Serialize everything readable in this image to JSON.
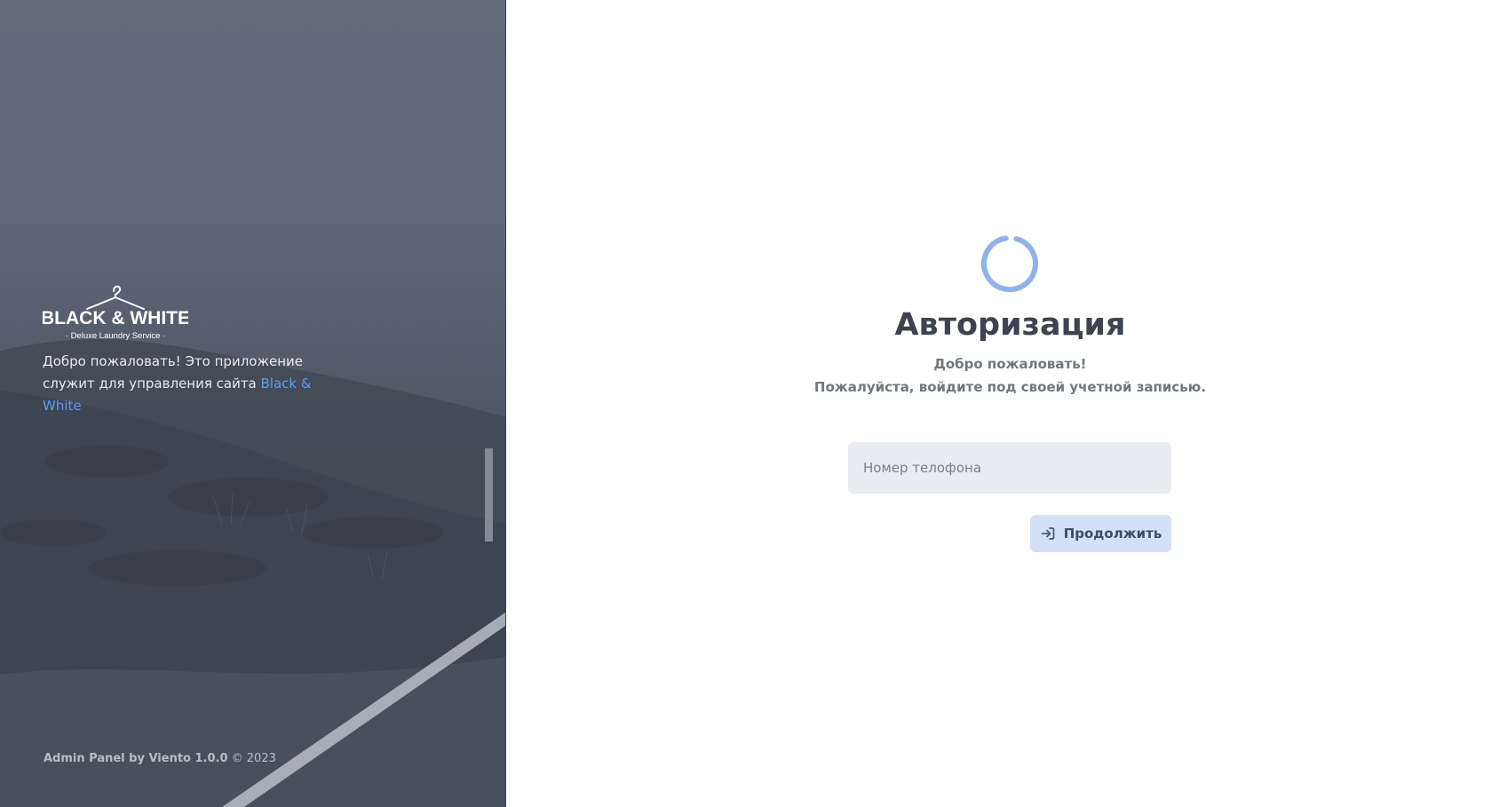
{
  "brand": {
    "logo_title": "BLACK & WHITE",
    "logo_tagline": "· Deluxe Laundry Service ·",
    "welcome_text": "Добро пожаловать! Это приложение служит для управления сайта ",
    "welcome_link": "Black & White",
    "footer_product": "Admin Panel by Viento 1.0.0",
    "footer_copyright": " © 2023"
  },
  "login": {
    "title": "Авторизация",
    "subtitle_line1": "Добро пожаловать!",
    "subtitle_line2": "Пожалуйста, войдите под своей учетной записью.",
    "phone_placeholder": "Номер телофона",
    "phone_value": "",
    "continue_label": "Продолжить",
    "loading": true
  },
  "icons": {
    "spinner": "loading-spinner-icon",
    "continue": "sign-in-icon",
    "logo": "hanger-icon"
  },
  "colors": {
    "accent": "#5f9af0",
    "spinner": "#8fb3e8",
    "button_bg": "#d3e0f7",
    "input_bg": "#e9edf2",
    "title": "#3d4350"
  }
}
